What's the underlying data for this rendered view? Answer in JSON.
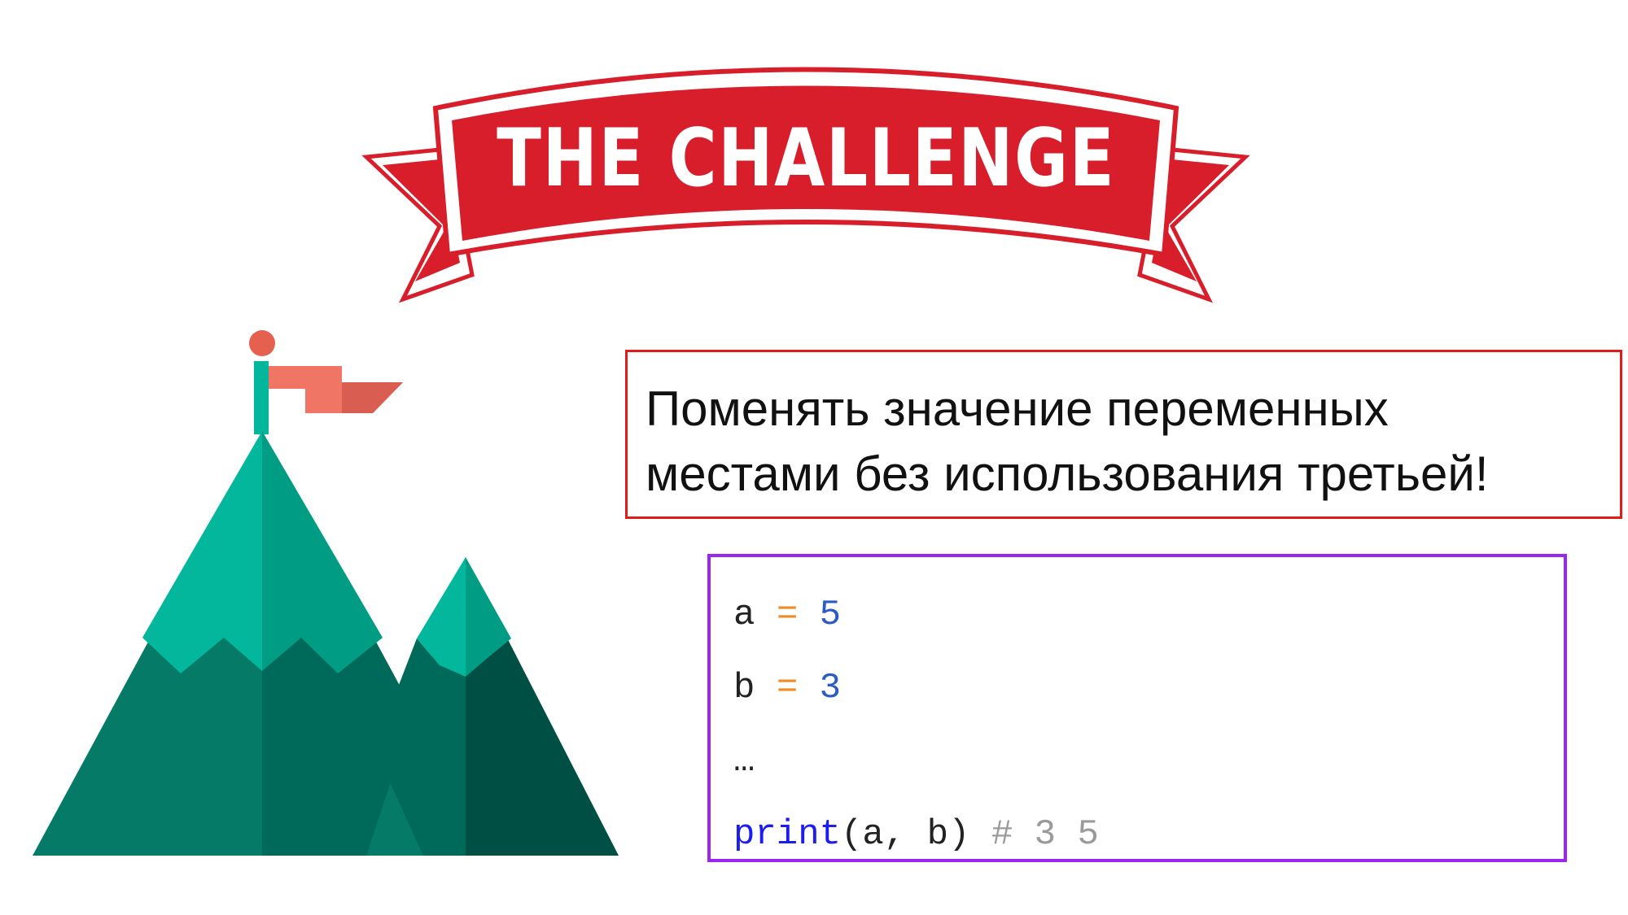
{
  "banner": {
    "title": "THE CHALLENGE",
    "colors": {
      "ribbon": "#d81e2a",
      "text": "#ffffff"
    }
  },
  "illustration": {
    "icon": "mountain-with-flag-icon",
    "colors": {
      "flag": "#f07565",
      "pole_ball": "#e5604f",
      "peak_light": "#02b79b",
      "peak_mid": "#009d84",
      "body_light": "#047a67",
      "body_dark": "#006a5a",
      "shadow": "#004f44"
    }
  },
  "task": {
    "line1": "Поменять значение переменных",
    "line2": "местами без использования третьей!",
    "border_color": "#e11a1a"
  },
  "code": {
    "border_color": "#9b26f2",
    "line1": {
      "var": "a",
      "op": "=",
      "num": "5"
    },
    "line2": {
      "var": "b",
      "op": "=",
      "num": "3"
    },
    "line3": "…",
    "line4": {
      "fn": "print",
      "args": "(a, b)",
      "comment": "# 3 5"
    }
  }
}
